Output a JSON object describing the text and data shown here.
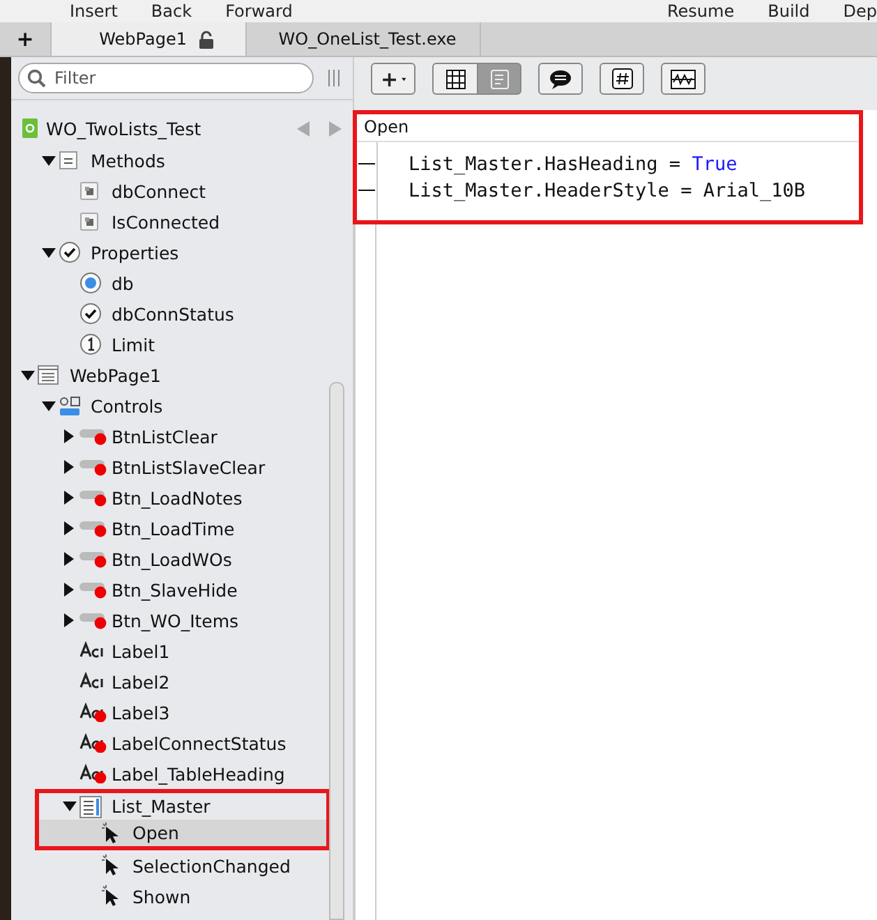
{
  "menu_bar": {
    "left_items": [
      "Insert",
      "Back",
      "Forward"
    ],
    "right_items": [
      "Resume",
      "Build",
      "Dep"
    ]
  },
  "tabs": [
    {
      "kind": "new",
      "label": "+",
      "selected": false
    },
    {
      "kind": "page",
      "label": "WebPage1",
      "selected": true
    },
    {
      "kind": "debug",
      "label": "WO_OneList_Test.exe",
      "selected": false
    }
  ],
  "sidebar": {
    "filter": {
      "placeholder": "Filter"
    },
    "project": "WO_TwoLists_Test",
    "project_items": [
      {
        "label": "Methods",
        "kind": "methods",
        "expanded": true,
        "children": [
          {
            "label": "dbConnect",
            "kind": "method"
          },
          {
            "label": "IsConnected",
            "kind": "method"
          }
        ]
      },
      {
        "label": "Properties",
        "kind": "properties",
        "expanded": true,
        "children": [
          {
            "label": "db",
            "kind": "object"
          },
          {
            "label": "dbConnStatus",
            "kind": "boolean"
          },
          {
            "label": "Limit",
            "kind": "integer"
          }
        ]
      }
    ],
    "tree": [
      {
        "label": "WebPage1",
        "kind": "page",
        "expanded": true,
        "children": [
          {
            "label": "Controls",
            "kind": "controls",
            "expanded": true,
            "children": [
              {
                "label": "BtnListClear",
                "kind": "button",
                "expanded": false,
                "error": true
              },
              {
                "label": "BtnListSlaveClear",
                "kind": "button",
                "expanded": false,
                "error": true
              },
              {
                "label": "Btn_LoadNotes",
                "kind": "button",
                "expanded": false,
                "error": true
              },
              {
                "label": "Btn_LoadTime",
                "kind": "button",
                "expanded": false,
                "error": true
              },
              {
                "label": "Btn_LoadWOs",
                "kind": "button",
                "expanded": false,
                "error": true
              },
              {
                "label": "Btn_SlaveHide",
                "kind": "button",
                "expanded": false,
                "error": true
              },
              {
                "label": "Btn_WO_Items",
                "kind": "button",
                "expanded": false,
                "error": true
              },
              {
                "label": "Label1",
                "kind": "label",
                "error": false
              },
              {
                "label": "Label2",
                "kind": "label",
                "error": false
              },
              {
                "label": "Label3",
                "kind": "label",
                "error": true
              },
              {
                "label": "LabelConnectStatus",
                "kind": "label",
                "error": true
              },
              {
                "label": "Label_TableHeading",
                "kind": "label",
                "error": true
              },
              {
                "label": "List_Master",
                "kind": "list",
                "expanded": true,
                "highlighted": true,
                "children": [
                  {
                    "label": "Open",
                    "kind": "event",
                    "selected": true,
                    "highlighted": true
                  },
                  {
                    "label": "SelectionChanged",
                    "kind": "event",
                    "selected": false
                  },
                  {
                    "label": "Shown",
                    "kind": "event",
                    "selected": false
                  }
                ]
              }
            ]
          }
        ]
      }
    ]
  },
  "toolbar": [
    {
      "kind": "add",
      "label": "+"
    },
    {
      "kind": "view-toggle"
    },
    {
      "kind": "comment"
    },
    {
      "kind": "hash"
    },
    {
      "kind": "wave"
    }
  ],
  "editor": {
    "title": "Open",
    "highlighted": true,
    "lines": [
      {
        "tokens": [
          {
            "kind": "plain",
            "text": "List_Master.HasHeading = "
          },
          {
            "kind": "keyword",
            "text": "True"
          }
        ]
      },
      {
        "tokens": [
          {
            "kind": "plain",
            "text": "List_Master.HeaderStyle = Arial_10B"
          }
        ]
      }
    ]
  }
}
